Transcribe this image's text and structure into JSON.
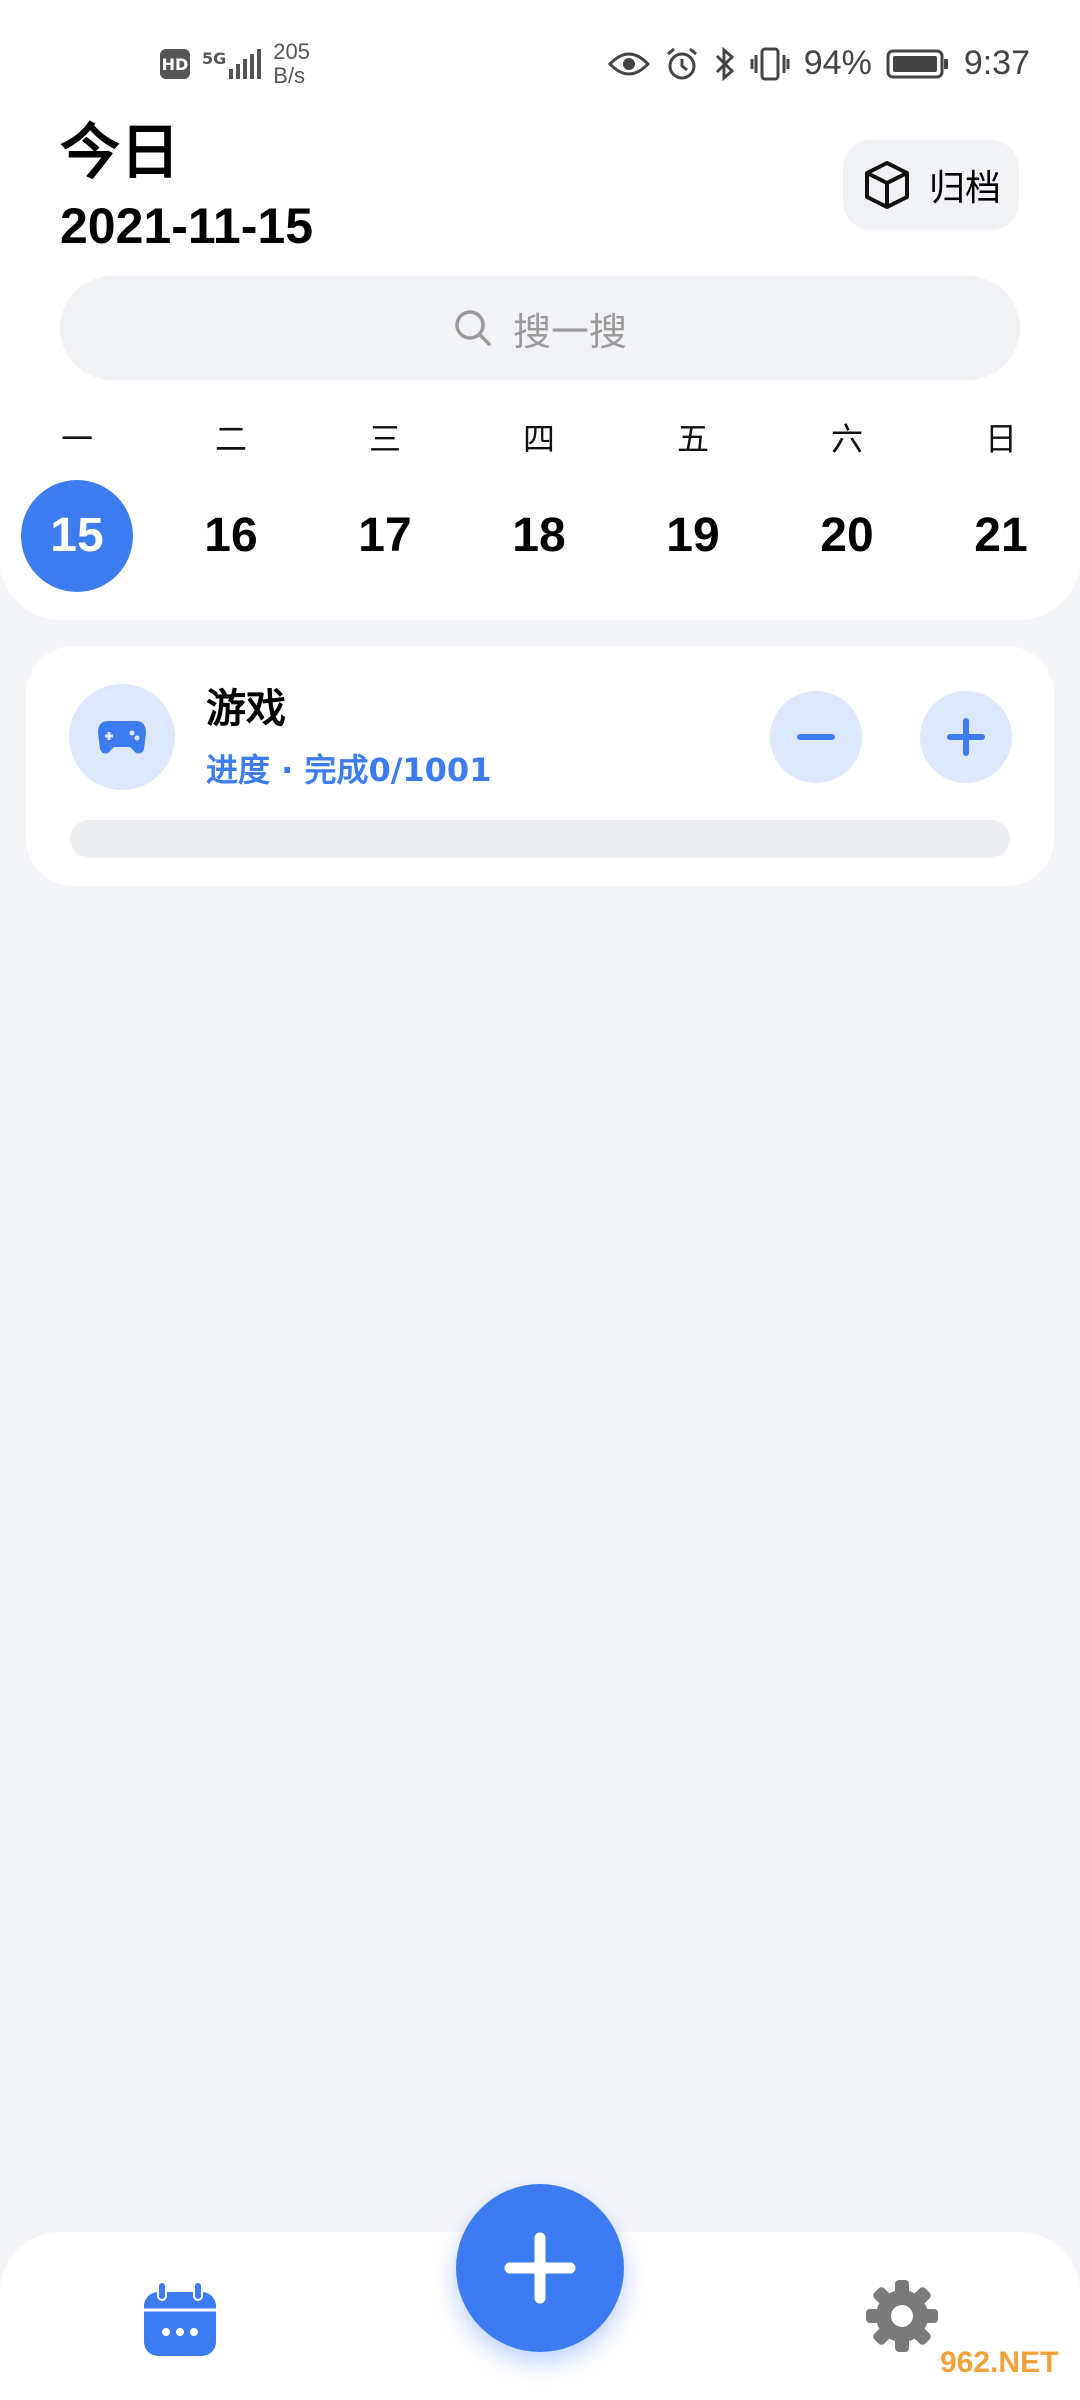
{
  "status_bar": {
    "net_speed_value": "205",
    "net_speed_unit": "B/s",
    "network_type": "5G",
    "hd_label": "HD",
    "battery": "94%",
    "time": "9:37",
    "icons": [
      "eye-icon",
      "alarm-icon",
      "bluetooth-icon",
      "vibrate-icon",
      "battery-icon"
    ]
  },
  "header": {
    "title": "今日",
    "date": "2021-11-15",
    "archive_label": "归档",
    "archive_icon": "cube-icon"
  },
  "search": {
    "placeholder": "搜一搜",
    "icon": "search-icon"
  },
  "week": {
    "weekdays": [
      "一",
      "二",
      "三",
      "四",
      "五",
      "六",
      "日"
    ],
    "days": [
      "15",
      "16",
      "17",
      "18",
      "19",
      "20",
      "21"
    ],
    "selected_index": 0
  },
  "task": {
    "name": "游戏",
    "progress_text": "进度 · 完成0/1001",
    "completed": 0,
    "total": 1001,
    "icon": "gamepad-icon"
  },
  "nav": {
    "left_icon": "calendar-icon",
    "center_icon": "plus-icon",
    "right_icon": "gear-icon"
  },
  "watermark": "962.NET",
  "colors": {
    "accent": "#3d7cf0",
    "accent_light": "#dde8fc",
    "background": "#f4f5f9",
    "card": "#ffffff"
  }
}
